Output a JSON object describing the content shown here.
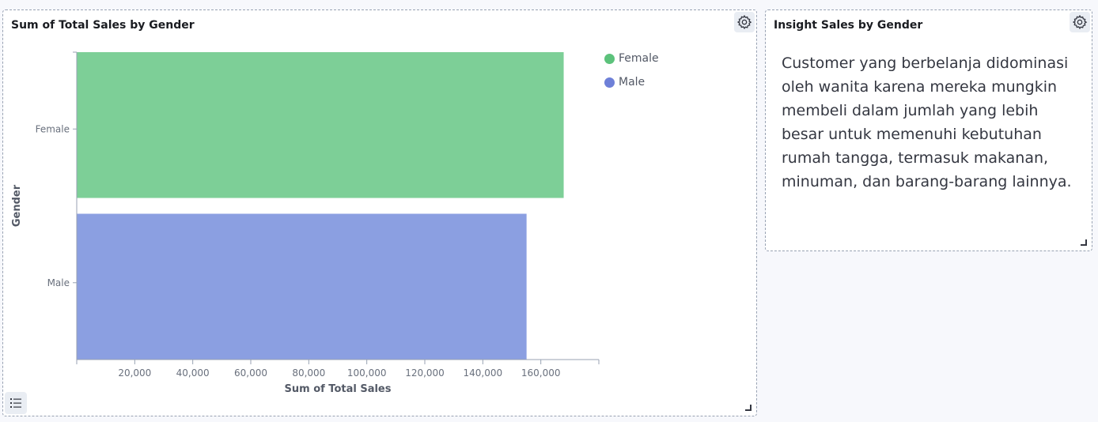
{
  "chart_panel": {
    "title": "Sum of Total Sales by Gender"
  },
  "insight_panel": {
    "title": "Insight Sales by Gender",
    "text": "Customer yang berbelanja didominasi oleh wanita karena mereka mungkin membeli dalam jumlah yang lebih besar untuk memenuhi kebutuhan rumah tangga, termasuk makanan, minuman, dan barang-barang lainnya."
  },
  "chart_data": {
    "type": "bar",
    "orientation": "horizontal",
    "title": "Sum of Total Sales by Gender",
    "xlabel": "Sum of Total Sales",
    "ylabel": "Gender",
    "categories": [
      "Female",
      "Male"
    ],
    "values": [
      167882,
      155084
    ],
    "colors": [
      "#7dcf97",
      "#8b9fe1"
    ],
    "xlim": [
      0,
      180000
    ],
    "xticks": [
      20000,
      40000,
      60000,
      80000,
      100000,
      120000,
      140000,
      160000
    ],
    "xtick_labels": [
      "20,000",
      "40,000",
      "60,000",
      "80,000",
      "100,000",
      "120,000",
      "140,000",
      "160,000"
    ],
    "legend": {
      "position": "top-right",
      "entries": [
        {
          "label": "Female",
          "color": "#54b399"
        },
        {
          "label": "Male",
          "color": "#6092c0"
        }
      ]
    },
    "grid": false
  },
  "legend_colors": [
    "#5cc27b",
    "#6e80d8"
  ]
}
